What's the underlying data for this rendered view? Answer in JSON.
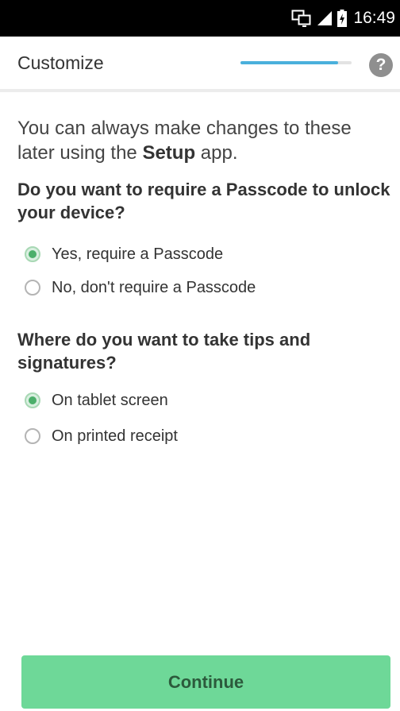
{
  "status_bar": {
    "time": "16:49",
    "icons": [
      "screen-cast-icon",
      "signal-icon",
      "battery-charging-icon"
    ]
  },
  "header": {
    "title": "Customize",
    "progress_fraction": 0.88,
    "help_label": "?"
  },
  "content": {
    "intro_before": "You can always make changes to these later using the ",
    "intro_bold": "Setup",
    "intro_after": " app.",
    "passcode": {
      "question": "Do you want to require a Passcode to unlock your device?",
      "options": [
        {
          "label": "Yes, require a Passcode",
          "checked": true
        },
        {
          "label": "No, don't require a Passcode",
          "checked": false
        }
      ]
    },
    "signatures": {
      "question": "Where do you want to take tips and signatures?",
      "options": [
        {
          "label": "On tablet screen",
          "checked": true
        },
        {
          "label": "On printed receipt",
          "checked": false
        }
      ]
    }
  },
  "footer": {
    "continue_label": "Continue"
  },
  "colors": {
    "accent_green": "#4caf6b",
    "button_green": "#6ed898",
    "progress_blue": "#4ab0dc"
  }
}
